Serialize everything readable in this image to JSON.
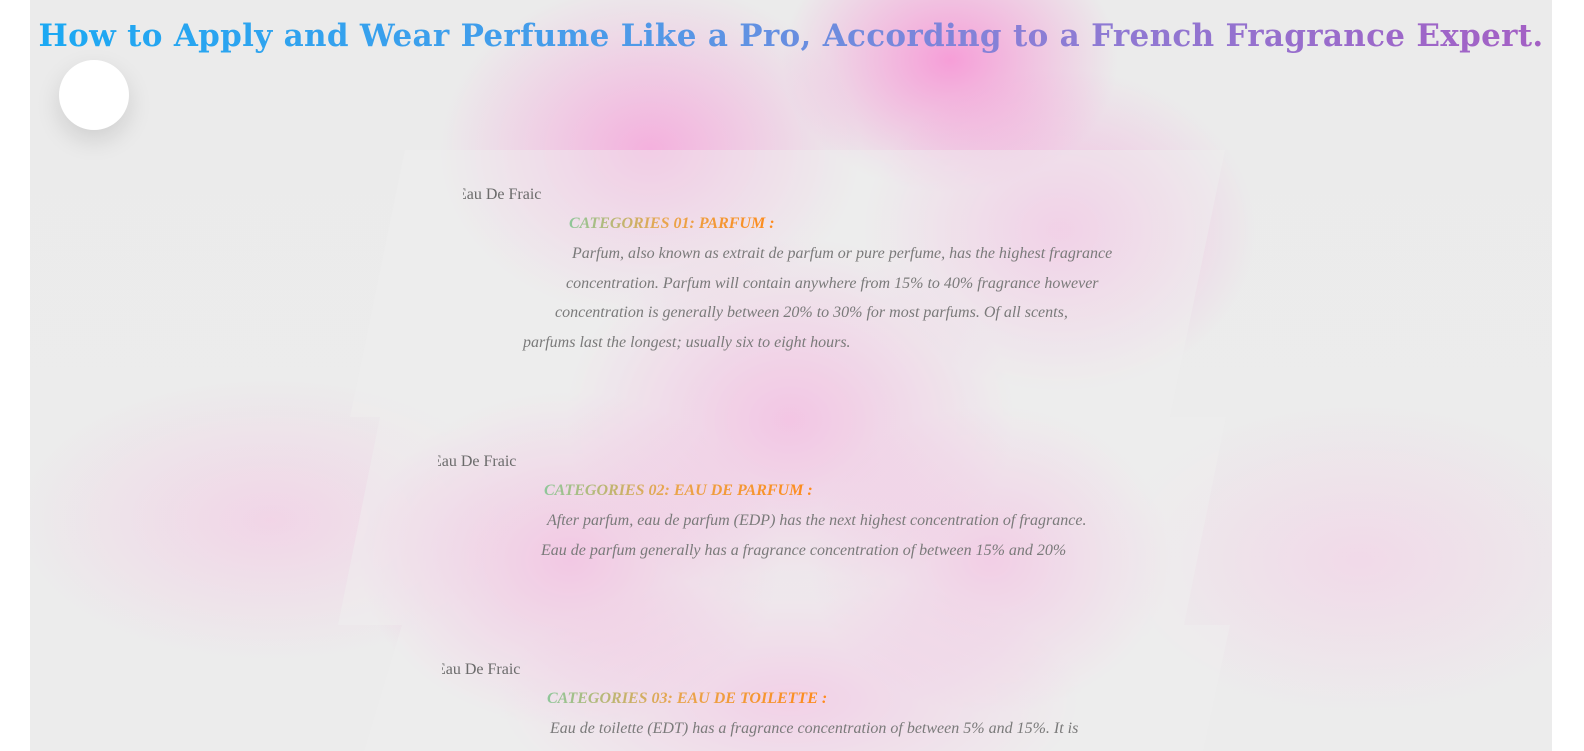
{
  "page": {
    "title": "How to Apply and Wear Perfume Like a Pro, According to a French Fragrance Expert."
  },
  "cards": [
    {
      "label": "Eau De Fraic",
      "heading": "CATEGORIES 01: PARFUM :",
      "lines": [
        "Parfum, also known as extrait de parfum or pure perfume, has the highest fragrance",
        "concentration. Parfum will contain anywhere from 15% to 40% fragrance however",
        "concentration is generally between 20% to 30% for most parfums. Of all scents,",
        "parfums last the longest; usually six to eight hours."
      ]
    },
    {
      "label": "Eau De Fraic",
      "heading": "CATEGORIES 02: EAU DE PARFUM :",
      "lines": [
        "After parfum, eau de parfum (EDP) has the next highest concentration of fragrance.",
        "Eau de parfum generally has a fragrance concentration of between 15% and 20%"
      ]
    },
    {
      "label": "Eau De Fraic",
      "heading": "CATEGORIES 03: EAU DE TOILETTE :",
      "lines": [
        "Eau de toilette (EDT) has a fragrance concentration of between 5% and 15%. It is"
      ]
    }
  ]
}
